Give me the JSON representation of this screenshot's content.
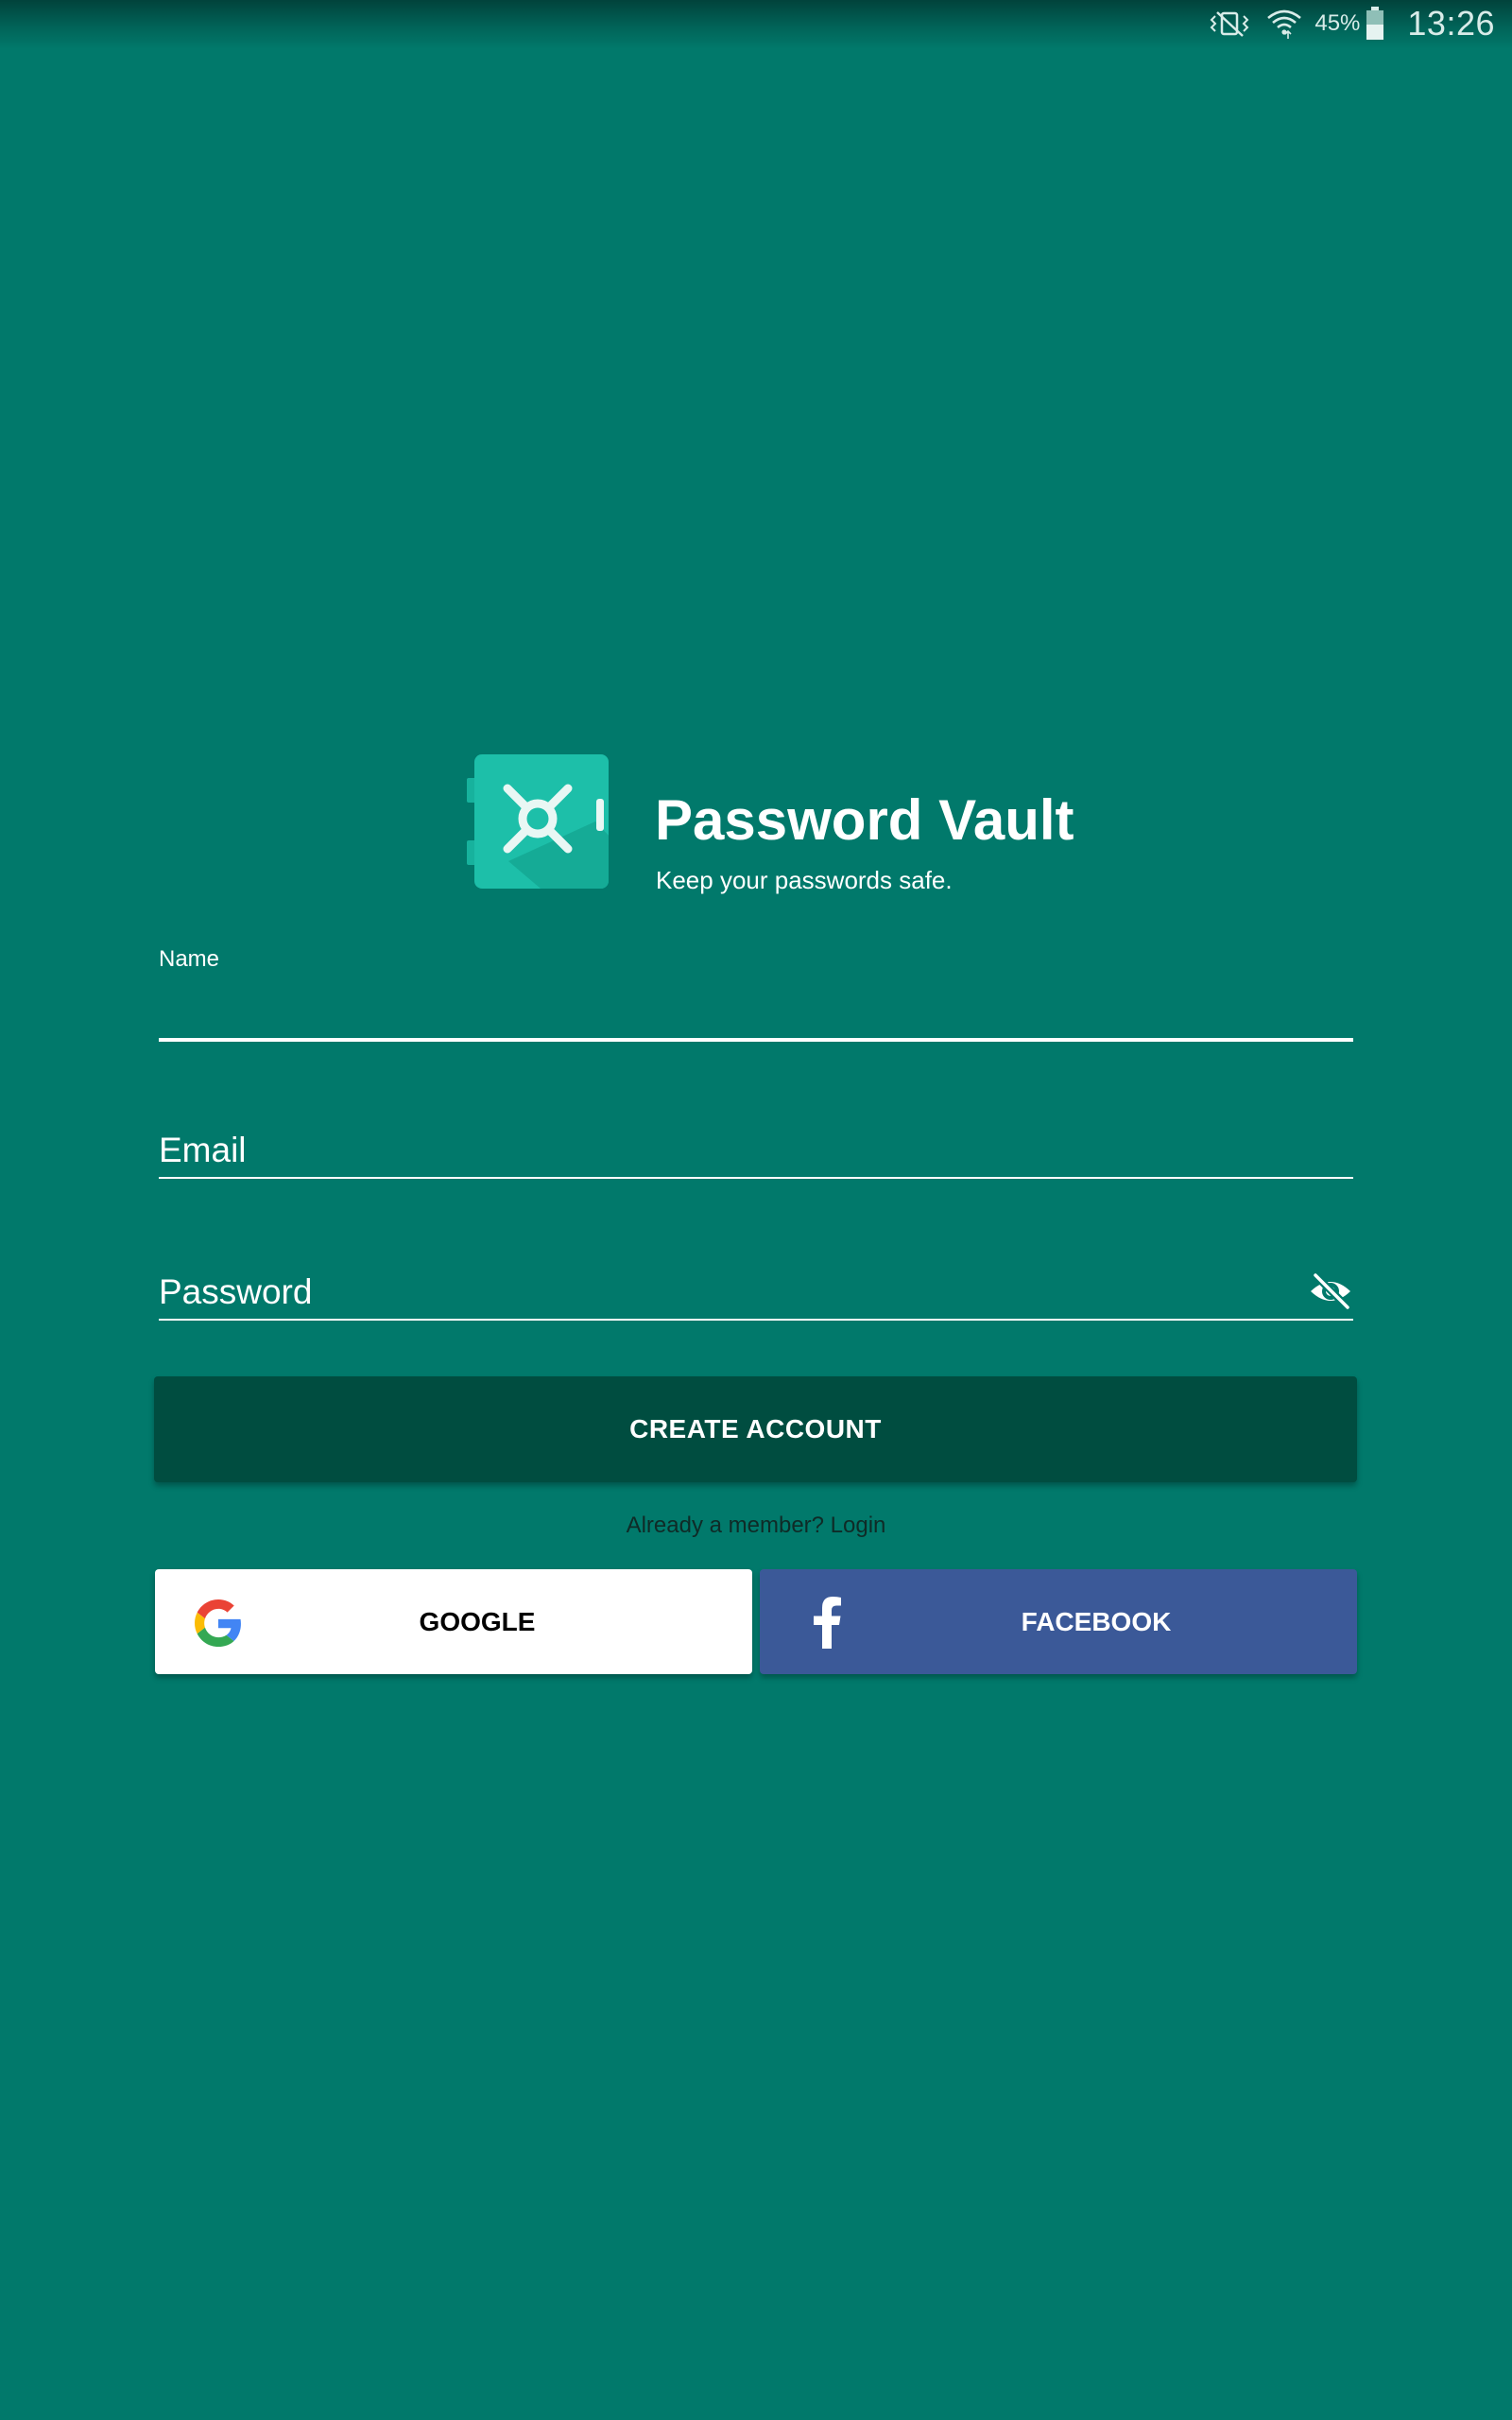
{
  "status_bar": {
    "battery_percent": "45%",
    "time": "13:26",
    "icons": [
      "vibrate-mute-icon",
      "wifi-icon",
      "battery-icon"
    ]
  },
  "app": {
    "title": "Password Vault",
    "subtitle": "Keep your passwords safe.",
    "logo_icon": "vault-icon"
  },
  "form": {
    "name": {
      "label": "Name",
      "value": ""
    },
    "email": {
      "placeholder": "Email",
      "value": ""
    },
    "password": {
      "placeholder": "Password",
      "value": "",
      "toggle_icon": "visibility-off-icon"
    }
  },
  "actions": {
    "create_account_label": "CREATE ACCOUNT",
    "login_prompt": "Already a member? Login"
  },
  "social": {
    "google_label": "GOOGLE",
    "facebook_label": "FACEBOOK"
  },
  "colors": {
    "background": "#01796b",
    "primary_dark": "#004d40",
    "facebook": "#3b5998",
    "logo_teal": "#1dbfa9"
  }
}
